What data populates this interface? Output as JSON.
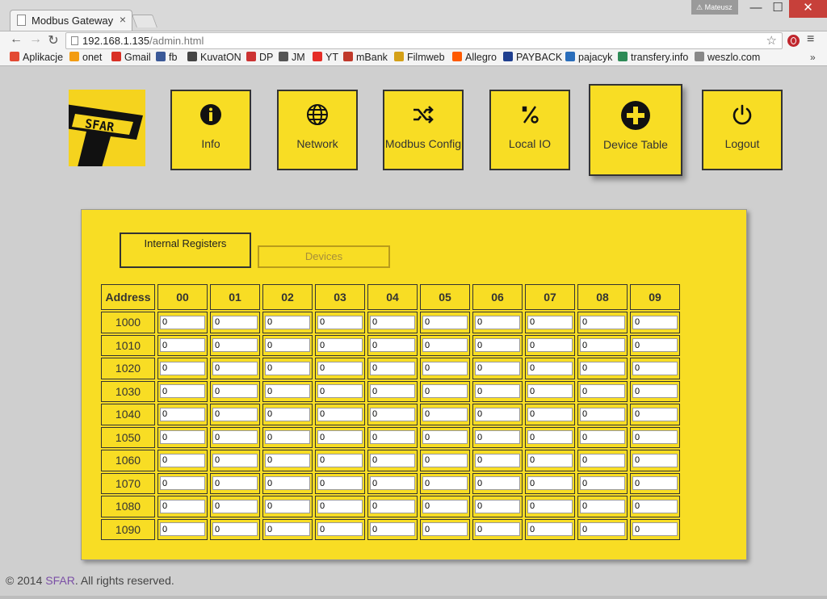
{
  "browser": {
    "tab_title": "Modbus Gateway",
    "tab_close": "×",
    "user_label": "Mateusz",
    "url_host": "192.168.1.135",
    "url_path": "/admin.html",
    "win_min": "—",
    "win_max": "☐",
    "win_close": "✕",
    "back": "←",
    "forward": "→",
    "reload": "↻",
    "star": "☆",
    "menu": "≡",
    "bookmarks_more": "»",
    "bookmarks": [
      {
        "label": "Aplikacje",
        "color": "#e34a33"
      },
      {
        "label": "onet",
        "color": "#f39c12"
      },
      {
        "label": "Gmail",
        "color": "#d93025"
      },
      {
        "label": "fb",
        "color": "#3b5998"
      },
      {
        "label": "KuvatON",
        "color": "#444444"
      },
      {
        "label": "DP",
        "color": "#cc3333"
      },
      {
        "label": "JM",
        "color": "#555555"
      },
      {
        "label": "YT",
        "color": "#e52d27"
      },
      {
        "label": "mBank",
        "color": "#c0392b"
      },
      {
        "label": "Filmweb",
        "color": "#d4a017"
      },
      {
        "label": "Allegro",
        "color": "#ff5a00"
      },
      {
        "label": "PAYBACK",
        "color": "#1f3f8f"
      },
      {
        "label": "pajacyk",
        "color": "#2a6ebb"
      },
      {
        "label": "transfery.info",
        "color": "#2e8b57"
      },
      {
        "label": "weszlo.com",
        "color": "#888888"
      }
    ]
  },
  "logo": {
    "text": "SFAR"
  },
  "nav": [
    {
      "label": "Info",
      "icon": "info-icon"
    },
    {
      "label": "Network",
      "icon": "globe-icon"
    },
    {
      "label": "Modbus Config",
      "icon": "shuffle-icon"
    },
    {
      "label": "Local IO",
      "icon": "percent-icon"
    },
    {
      "label": "Device Table",
      "icon": "plus-circle-icon",
      "active": true
    },
    {
      "label": "Logout",
      "icon": "power-icon"
    }
  ],
  "panel": {
    "tabs": {
      "internal": "Internal Registers",
      "devices": "Devices"
    },
    "table": {
      "headers": [
        "Address",
        "00",
        "01",
        "02",
        "03",
        "04",
        "05",
        "06",
        "07",
        "08",
        "09"
      ],
      "rows": [
        {
          "address": "1000",
          "values": [
            "0",
            "0",
            "0",
            "0",
            "0",
            "0",
            "0",
            "0",
            "0",
            "0"
          ]
        },
        {
          "address": "1010",
          "values": [
            "0",
            "0",
            "0",
            "0",
            "0",
            "0",
            "0",
            "0",
            "0",
            "0"
          ]
        },
        {
          "address": "1020",
          "values": [
            "0",
            "0",
            "0",
            "0",
            "0",
            "0",
            "0",
            "0",
            "0",
            "0"
          ]
        },
        {
          "address": "1030",
          "values": [
            "0",
            "0",
            "0",
            "0",
            "0",
            "0",
            "0",
            "0",
            "0",
            "0"
          ]
        },
        {
          "address": "1040",
          "values": [
            "0",
            "0",
            "0",
            "0",
            "0",
            "0",
            "0",
            "0",
            "0",
            "0"
          ]
        },
        {
          "address": "1050",
          "values": [
            "0",
            "0",
            "0",
            "0",
            "0",
            "0",
            "0",
            "0",
            "0",
            "0"
          ]
        },
        {
          "address": "1060",
          "values": [
            "0",
            "0",
            "0",
            "0",
            "0",
            "0",
            "0",
            "0",
            "0",
            "0"
          ]
        },
        {
          "address": "1070",
          "values": [
            "0",
            "0",
            "0",
            "0",
            "0",
            "0",
            "0",
            "0",
            "0",
            "0"
          ]
        },
        {
          "address": "1080",
          "values": [
            "0",
            "0",
            "0",
            "0",
            "0",
            "0",
            "0",
            "0",
            "0",
            "0"
          ]
        },
        {
          "address": "1090",
          "values": [
            "0",
            "0",
            "0",
            "0",
            "0",
            "0",
            "0",
            "0",
            "0",
            "0"
          ]
        }
      ]
    }
  },
  "footer": {
    "prefix": "© 2014 ",
    "brand": "SFAR",
    "suffix": ". All rights reserved."
  },
  "colors": {
    "accent": "#f8dd24",
    "page_bg": "#cfcfcf",
    "border": "#333333"
  }
}
